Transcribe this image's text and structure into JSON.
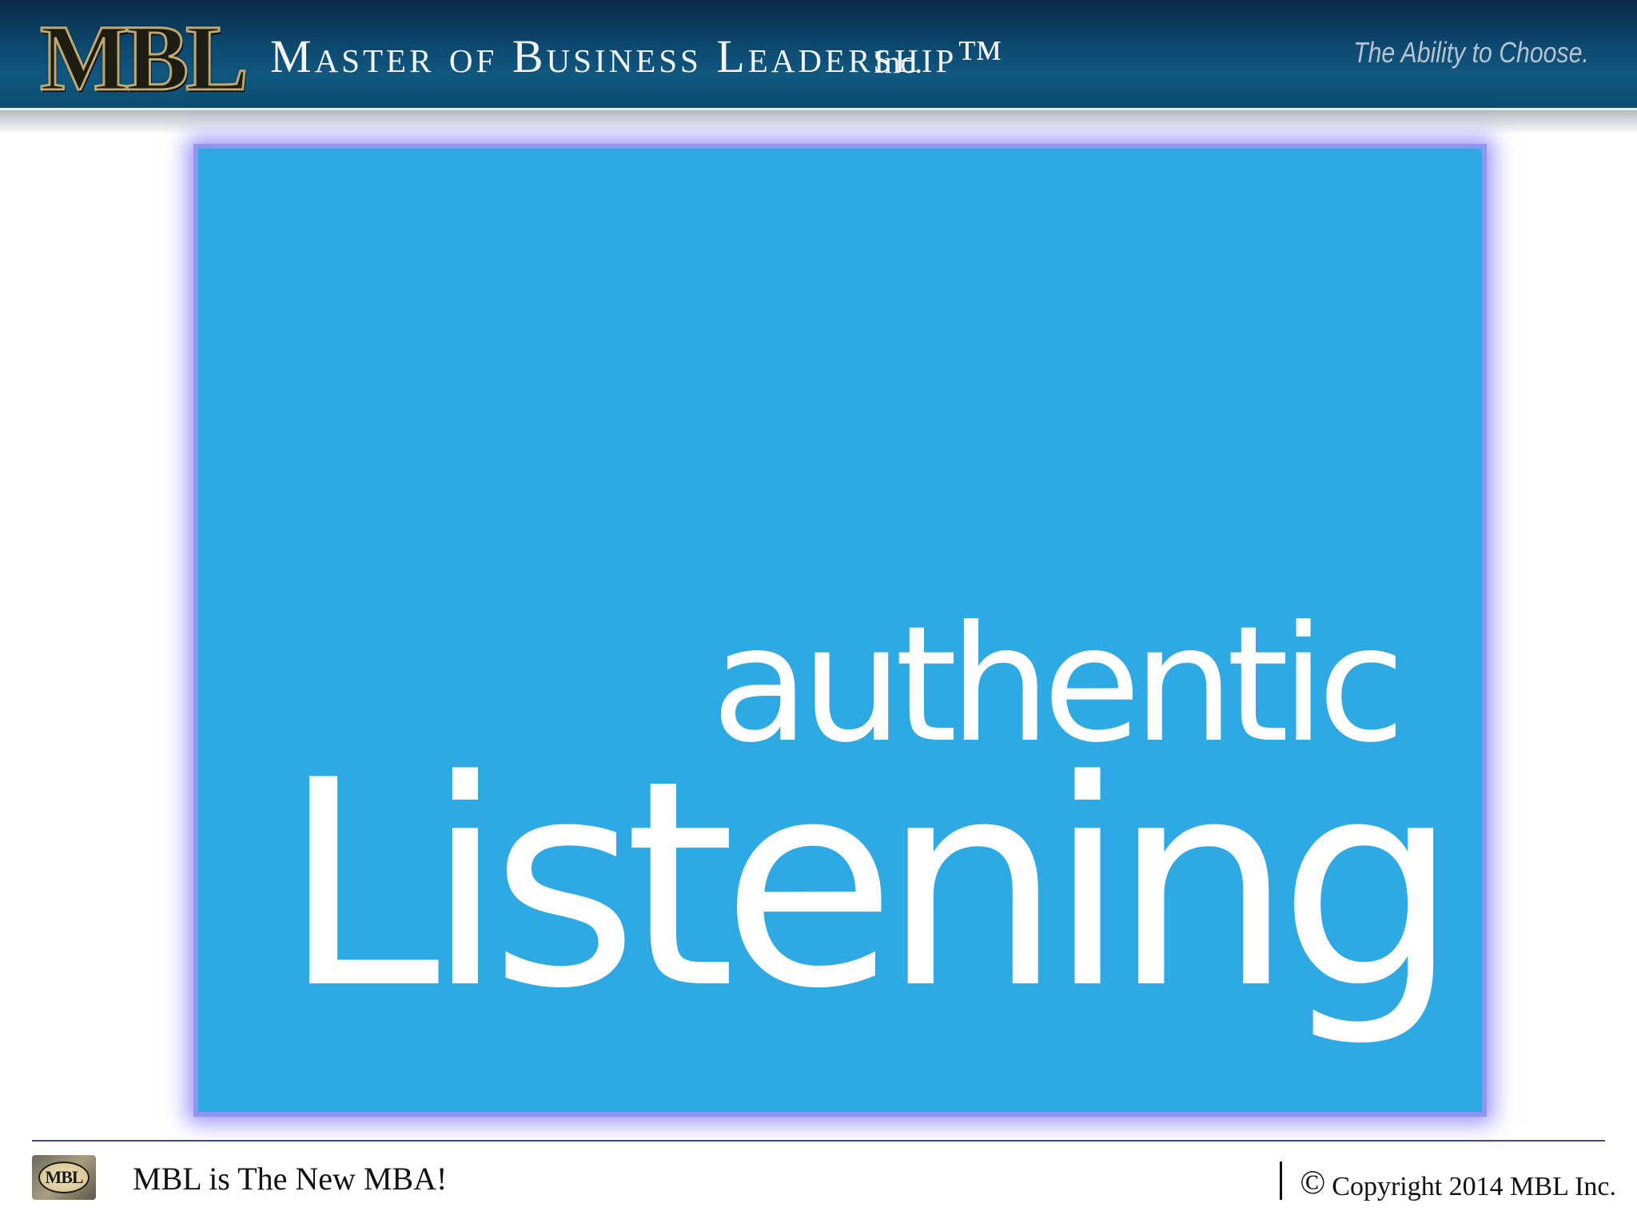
{
  "header": {
    "logo_text": "MBL",
    "company_name": "Master of Business Leadership™",
    "company_suffix": "Inc.",
    "tagline": "The Ability to Choose.",
    "banner_color": "#0d4a72"
  },
  "main_image": {
    "line1": "authentic",
    "line2": "Listening",
    "background_color": "#2ea9e4",
    "glow_color": "#8f95f2"
  },
  "footer": {
    "logo_text": "MBL",
    "motto": "MBL is The New MBA!",
    "copyright_symbol": "©",
    "copyright_text": "Copyright 2014 MBL Inc."
  }
}
